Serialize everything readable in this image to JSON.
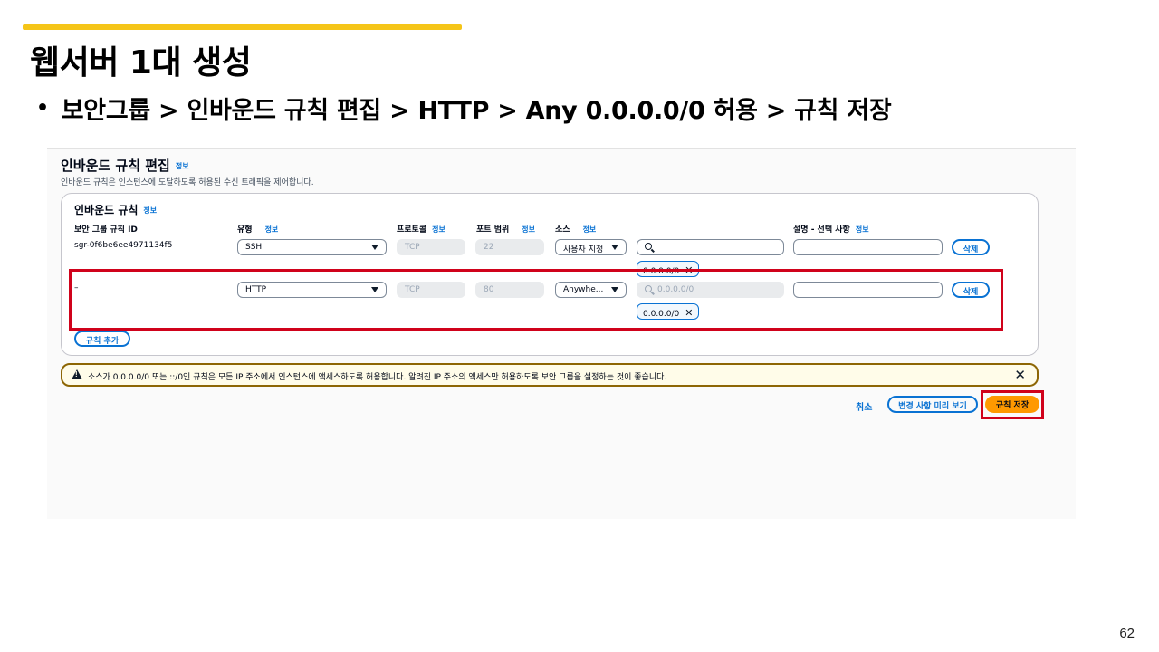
{
  "slide": {
    "title": "웹서버 1대 생성",
    "bullet": "보안그룹 > 인바운드 규칙 편집 > HTTP > Any 0.0.0.0/0 허용 > 규칙 저장",
    "page_number": "62",
    "accent_color": "#f5c518",
    "highlight_color": "#d0021b"
  },
  "console": {
    "title": "인바운드 규칙 편집",
    "info": "정보",
    "description": "인바운드 규칙은 인스턴스에 도달하도록 허용된 수신 트래픽을 제어합니다.",
    "card_title": "인바운드 규칙",
    "columns": {
      "rule_id": "보안 그룹 규칙 ID",
      "type": "유형",
      "protocol": "프로토콜",
      "port": "포트 범위",
      "source": "소스",
      "description": "설명 - 선택 사항"
    },
    "rules": [
      {
        "rule_id": "sgr-0f6be6ee4971134f5",
        "type": "SSH",
        "protocol": "TCP",
        "port": "22",
        "source": "사용자 지정",
        "search": "",
        "token": "0.0.0.0/0",
        "delete": "삭제"
      },
      {
        "rule_id": "–",
        "type": "HTTP",
        "protocol": "TCP",
        "port": "80",
        "source": "Anywhe...",
        "search": "0.0.0.0/0",
        "token": "0.0.0.0/0",
        "delete": "삭제"
      }
    ],
    "add_rule": "규칙 추가",
    "warning": "소스가 0.0.0.0/0 또는 ::/0인 규칙은 모든 IP 주소에서 인스턴스에 액세스하도록 허용합니다. 알려진 IP 주소의 액세스만 허용하도록 보안 그룹을 설정하는 것이 좋습니다.",
    "cancel": "취소",
    "preview": "변경 사항 미리 보기",
    "save": "규칙 저장",
    "primary_color": "#ff9900",
    "link_color": "#0972d3"
  }
}
